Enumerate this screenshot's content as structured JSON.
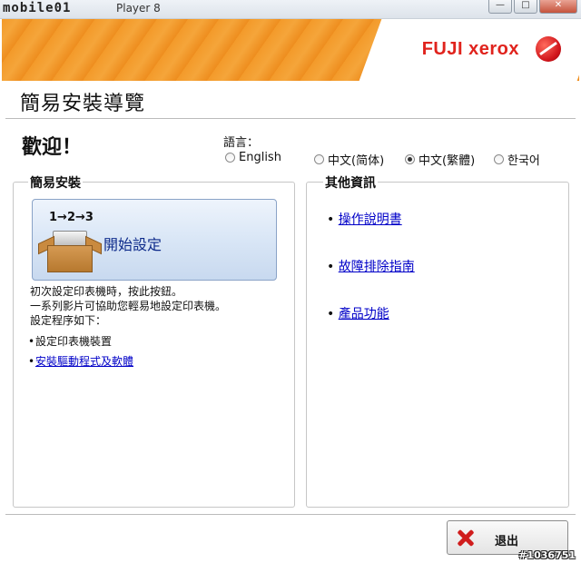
{
  "window": {
    "app_logo": "mobile01",
    "title": "Player 8",
    "min_glyph": "—",
    "max_glyph": "□",
    "close_glyph": "✕"
  },
  "banner": {
    "brand_fuji": "FUJI",
    "brand_xerox": "xerox",
    "brand_color": "#e0231d"
  },
  "page_title": "簡易安裝導覽",
  "welcome": "歡迎！",
  "language": {
    "label": "語言：",
    "options": [
      {
        "label": "English",
        "selected": false
      },
      {
        "label": "中文(简体)",
        "selected": false
      },
      {
        "label": "中文(繁體)",
        "selected": true
      },
      {
        "label": "한국어",
        "selected": false
      }
    ]
  },
  "easy_install": {
    "title": "簡易安裝",
    "steps": "1→2→3",
    "start_button": "開始設定",
    "desc_lines": [
      "初次設定印表機時，按此按鈕。",
      "一系列影片可協助您輕易地設定印表機。",
      "設定程序如下："
    ],
    "bullet": "•",
    "items": [
      {
        "label": "設定印表機裝置",
        "link": false
      },
      {
        "label": "安裝驅動程式及軟體",
        "link": true
      }
    ]
  },
  "other_info": {
    "title": "其他資訊",
    "bullet": "•",
    "links": [
      "操作說明書",
      "故障排除指南",
      "產品功能"
    ]
  },
  "exit_button": "退出",
  "watermark": "#1036751"
}
